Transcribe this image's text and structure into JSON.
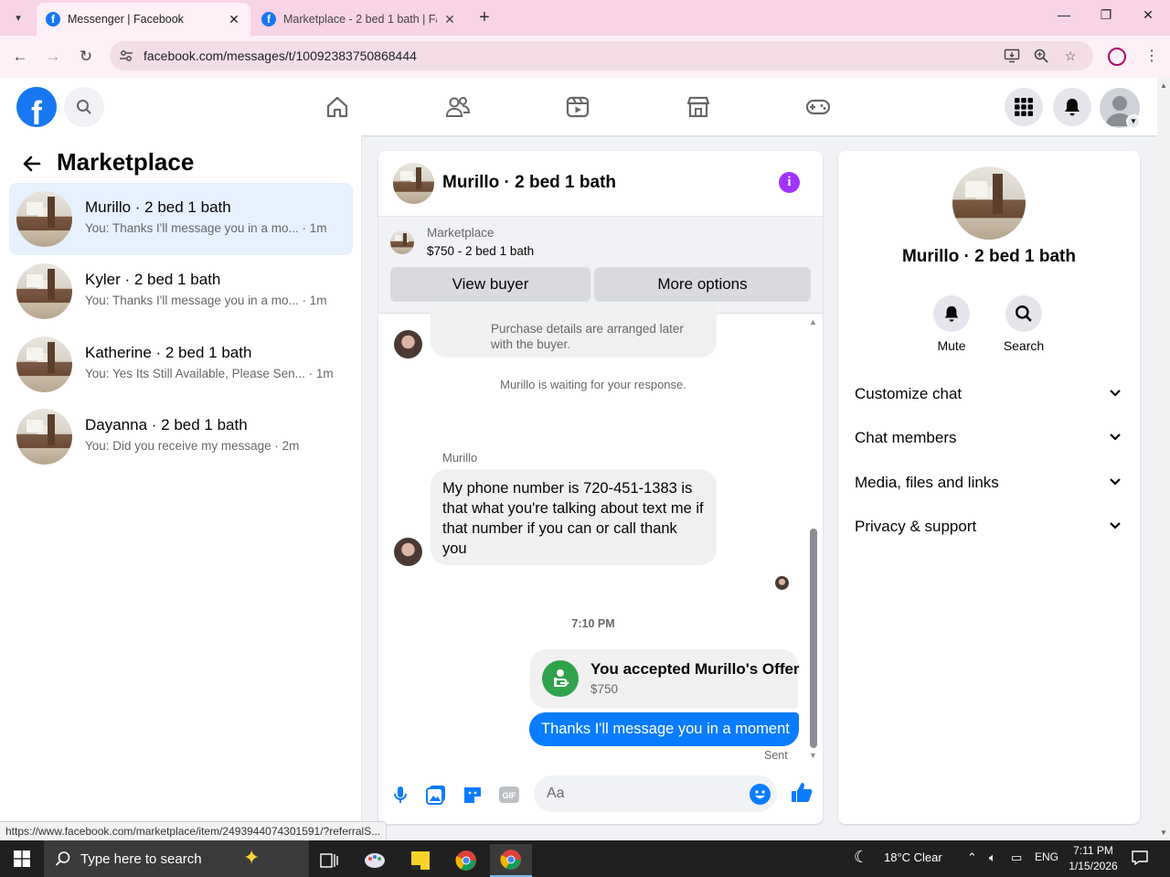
{
  "browser": {
    "tabs": [
      {
        "title": "Messenger | Facebook",
        "active": true
      },
      {
        "title": "Marketplace - 2 bed 1 bath | Fa",
        "active": false
      }
    ],
    "url": "facebook.com/messages/t/10092383750868444"
  },
  "left_panel": {
    "title": "Marketplace",
    "conversations": [
      {
        "name": "Murillo · 2 bed 1 bath",
        "preview": "You: Thanks I'll message you in a mo... · 1m",
        "active": true
      },
      {
        "name": "Kyler · 2 bed 1 bath",
        "preview": "You: Thanks I'll message you in a mo... · 1m",
        "active": false
      },
      {
        "name": "Katherine · 2 bed 1 bath",
        "preview": "You: Yes Its Still Available, Please Sen... · 1m",
        "active": false
      },
      {
        "name": "Dayanna · 2 bed 1 bath",
        "preview": "You: Did you receive my message · 2m",
        "active": false
      }
    ]
  },
  "chat": {
    "title": "Murillo · 2 bed 1 bath",
    "marketplace_label": "Marketplace",
    "listing_price": "$750 - 2 bed 1 bath",
    "view_buyer": "View buyer",
    "more_options": "More options",
    "purchase_text": "Purchase details are arranged later with the buyer.",
    "waiting_text": "Murillo is waiting for your response.",
    "sender_name": "Murillo",
    "phone_message": "My phone number is 720-451-1383 is that what you're talking about text me if that number if you can or call thank you",
    "timestamp": "7:10 PM",
    "offer_title": "You accepted Murillo's Offer",
    "offer_price": "$750",
    "my_message": "Thanks I'll message you in a moment",
    "sent_label": "Sent",
    "input_placeholder": "Aa"
  },
  "right_panel": {
    "name": "Murillo · 2 bed 1 bath",
    "mute": "Mute",
    "search": "Search",
    "sections": [
      "Customize chat",
      "Chat members",
      "Media, files and links",
      "Privacy & support"
    ]
  },
  "status_url": "https://www.facebook.com/marketplace/item/2493944074301591/?referralS...",
  "taskbar": {
    "search_placeholder": "Type here to search",
    "weather": "18°C  Clear",
    "language": "ENG",
    "time": "7:11 PM",
    "date": "1/15/2026"
  },
  "colors": {
    "facebook_blue": "#1877f2",
    "messenger_blue": "#0a7cff",
    "info_purple": "#a033ff",
    "offer_green": "#31a24c"
  }
}
